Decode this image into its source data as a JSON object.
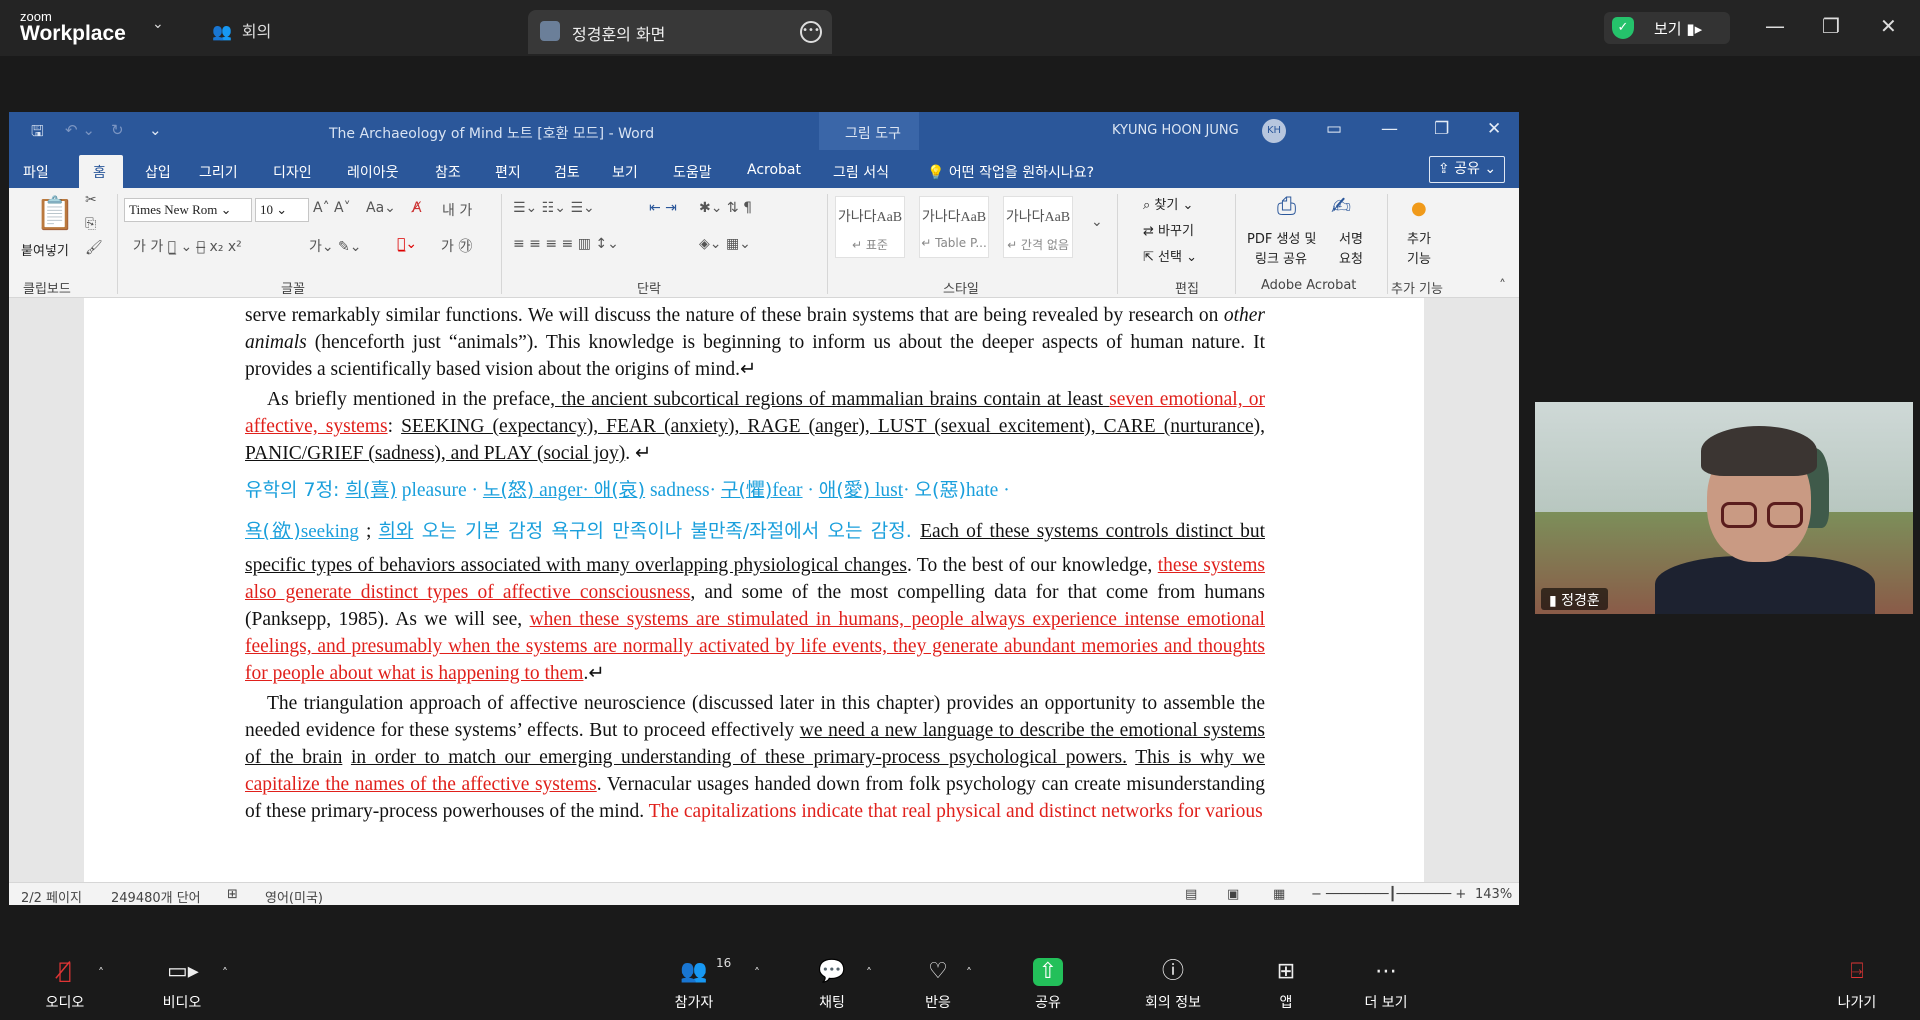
{
  "zoom": {
    "logo_small": "zoom",
    "logo_big": "Workplace",
    "meeting_label": "회의",
    "tab_title": "정경훈의 화면",
    "view_label": "보기",
    "participant_count": "16",
    "bottom": {
      "audio": "오디오",
      "video": "비디오",
      "participants": "참가자",
      "chat": "채팅",
      "react": "반응",
      "share": "공유",
      "info": "회의 정보",
      "apps": "앱",
      "more": "더 보기",
      "leave": "나가기"
    },
    "video_tile_name": "정경훈"
  },
  "word": {
    "title": "The Archaeology of Mind 노트 [호환 모드]  -  Word",
    "picture_tools": "그림 도구",
    "user_name": "KYUNG HOON JUNG",
    "user_initials": "KH",
    "tabs": [
      "파일",
      "홈",
      "삽입",
      "그리기",
      "디자인",
      "레이아웃",
      "참조",
      "편지",
      "검토",
      "보기",
      "도움말",
      "Acrobat",
      "그림 서식"
    ],
    "tell_me": "어떤 작업을 원하시나요?",
    "share": "공유",
    "ribbon": {
      "paste": "붙여넣기",
      "clipboard": "클립보드",
      "font_name": "Times New Rom",
      "font_size": "10",
      "font_group": "글꼴",
      "paragraph_group": "단락",
      "styles_group": "스타일",
      "edit_group": "편집",
      "acrobat_group": "Adobe Acrobat",
      "addins_group": "추가 기능",
      "styles": [
        {
          "preview": "가나다AaB",
          "name": "↵ 표준"
        },
        {
          "preview": "가나다AaB",
          "name": "↵ Table P..."
        },
        {
          "preview": "가나다AaB",
          "name": "↵ 간격 없음"
        }
      ],
      "find": "찾기",
      "replace": "바꾸기",
      "select": "선택",
      "pdf_create": "PDF 생성 및",
      "pdf_share": "링크 공유",
      "sign": "서명",
      "request": "요청",
      "addins_1": "추가",
      "addins_2": "기능"
    },
    "status": {
      "page": "2/2 페이지",
      "words": "249480개 단어",
      "lang": "영어(미국)",
      "zoom": "143%"
    },
    "doc": {
      "p1": "serve remarkably similar functions. We will discuss the nature of these brain systems that are being revealed by research on ",
      "p1_em": "other animals",
      "p1_b": " (henceforth just “animals”). This knowledge is beginning to inform us about the deeper aspects of human nature. It provides a scientifically based vision about the origins of mind.↵",
      "p2_a": "As briefly mentioned in the preface",
      "p2_b": ", the ancient subcortical regions of mammalian brains contain at least ",
      "p2_c": "seven emotional, or affective, systems",
      "p2_d": ": ",
      "p2_e": "SEEKING (expectancy), FEAR (anxiety), RAGE (anger), LUST (sexual excitement), CARE (nurturance), PANIC/GRIEF (sadness), and PLAY (social joy)",
      "p2_f": ". ↵",
      "kr1_a": "유학의 7정: ",
      "kr1_b": "희(喜)",
      "kr1_c": " pleasure · ",
      "kr1_d": "노(怒)",
      "kr1_e": " anger· ",
      "kr1_f": "애(哀)",
      "kr1_g": " sadness· ",
      "kr1_h": "구(懼)",
      "kr1_i": "fear",
      "kr1_j": " · ",
      "kr1_k": "애(愛)",
      "kr1_l": " lust",
      "kr1_m": "· ",
      "kr1_n": "오(惡)",
      "kr1_o": "hate · ",
      "kr2_a": "욕(欲)",
      "kr2_b": "seeking",
      "kr2_c": " ; ",
      "kr2_d": "희와",
      "kr2_e": " 오는 기본 감정 욕구의 만족이나 불만족/좌절에서 오는 감정. ",
      "p3_a": "Each of these systems controls distinct but specific types of behaviors associated with many overlapping physiological changes",
      "p3_b": ". To the best of our knowledge, ",
      "p3_c": "these systems also generate distinct types of affective consciousness",
      "p3_d": ", and some of the most compelling data for that come from humans (Panksepp, 1985). As we will see, ",
      "p3_e": "when these systems are stimulated in humans, people always experience intense emotional feelings, and presumably when the systems are normally activated by life events, they generate abundant memories and thoughts for people about what is happening to them",
      "p3_f": ".↵",
      "p4_a": "The triangulation approach of affective neuroscience (discussed later in this chapter) provides an opportunity to assemble the needed evidence for these systems’ effects. But to proceed effectively ",
      "p4_b": "we need a new language to describe the emotional systems of the brain",
      "p4_c": " ",
      "p4_d": "in order to match our emerging understanding of these primary-process psychological powers.",
      "p4_e": " ",
      "p4_f": "This is why we",
      "p4_g": " capitalize the names of the affective systems",
      "p4_h": ". Vernacular usages handed down from folk psychology can create misunderstanding of these primary-process powerhouses of the mind. ",
      "p4_i": "The capitalizations indicate that real physical and distinct networks for various"
    }
  }
}
